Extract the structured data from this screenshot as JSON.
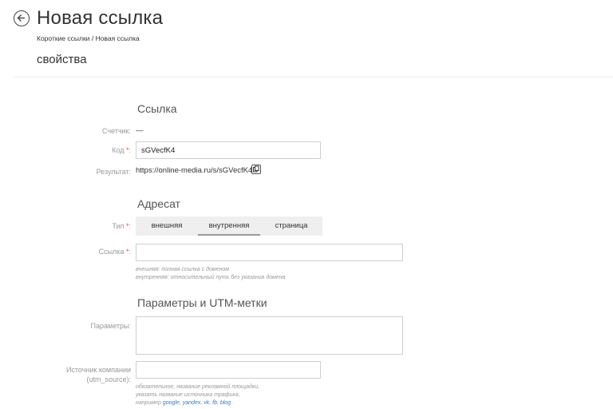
{
  "header": {
    "title": "Новая ссылка",
    "breadcrumb": {
      "parent": "Короткие ссылки",
      "separator": "/",
      "current": "Новая ссылка"
    },
    "section": "свойства"
  },
  "link_group": {
    "title": "Ссылка",
    "counter": {
      "label": "Счетчик:",
      "value": "—"
    },
    "code": {
      "label": "Код",
      "required_mark": "*",
      "colon": ":",
      "value": "sGVecfK4"
    },
    "result": {
      "label": "Результат:",
      "value": "https://online-media.ru/s/sGVecfK4/"
    }
  },
  "target_group": {
    "title": "Адресат",
    "type": {
      "label": "Тип",
      "required_mark": "*",
      "colon": ":",
      "tabs": [
        {
          "label": "внешняя"
        },
        {
          "label": "внутренняя"
        },
        {
          "label": "страница"
        }
      ],
      "active_tab": "внутренняя"
    },
    "link": {
      "label": "Ссылка",
      "required_mark": "*",
      "colon": ":",
      "value": "",
      "hint_external": "внешняя: полная ссылка с доменом",
      "hint_internal": "внутренняя: относительный путь без указания домена"
    }
  },
  "params_group": {
    "title": "Параметры и UTM-метки",
    "params": {
      "label": "Параметры:",
      "value": ""
    },
    "utm_source": {
      "label_line1": "Источник компании",
      "label_line2": "(utm_source):",
      "value": "",
      "hint_line1": "обязательное, название рекламной площадки,",
      "hint_line2": "указать название источника трафика,",
      "hint_prefix": "например",
      "examples": [
        "google",
        "yandex",
        "vk",
        "fb",
        "blog"
      ],
      "example_separator": ", "
    }
  },
  "icons": {
    "back": "back-arrow-circle-icon",
    "copy": "copy-icon"
  }
}
